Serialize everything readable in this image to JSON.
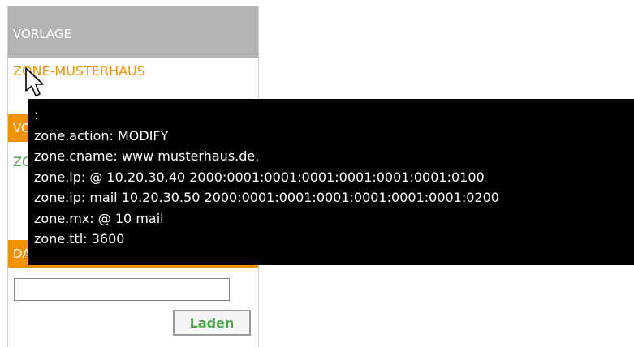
{
  "sidebar": {
    "vorlage_header": "VORLAGE",
    "vorlage_link": "ZONE-MUSTERHAUS",
    "second_header": "VO",
    "second_link": "ZO",
    "third_header": "DA",
    "file_input": {
      "value": "",
      "placeholder": ""
    },
    "load_button": "Laden"
  },
  "tooltip": {
    "lines": [
      ":",
      "zone.action: MODIFY",
      "zone.cname: www musterhaus.de.",
      "zone.ip: @ 10.20.30.40 2000:0001:0001:0001:0001:0001:0001:0100",
      "zone.ip: mail 10.20.30.50 2000:0001:0001:0001:0001:0001:0001:0200",
      "zone.mx: @ 10 mail",
      "zone.ttl: 3600"
    ]
  },
  "colors": {
    "accent_orange": "#f39200",
    "header_gray": "#b3b3b3",
    "link_green": "#4aa64a",
    "tooltip_bg": "#000000"
  },
  "icons": {
    "cursor": "mouse-pointer-icon"
  }
}
